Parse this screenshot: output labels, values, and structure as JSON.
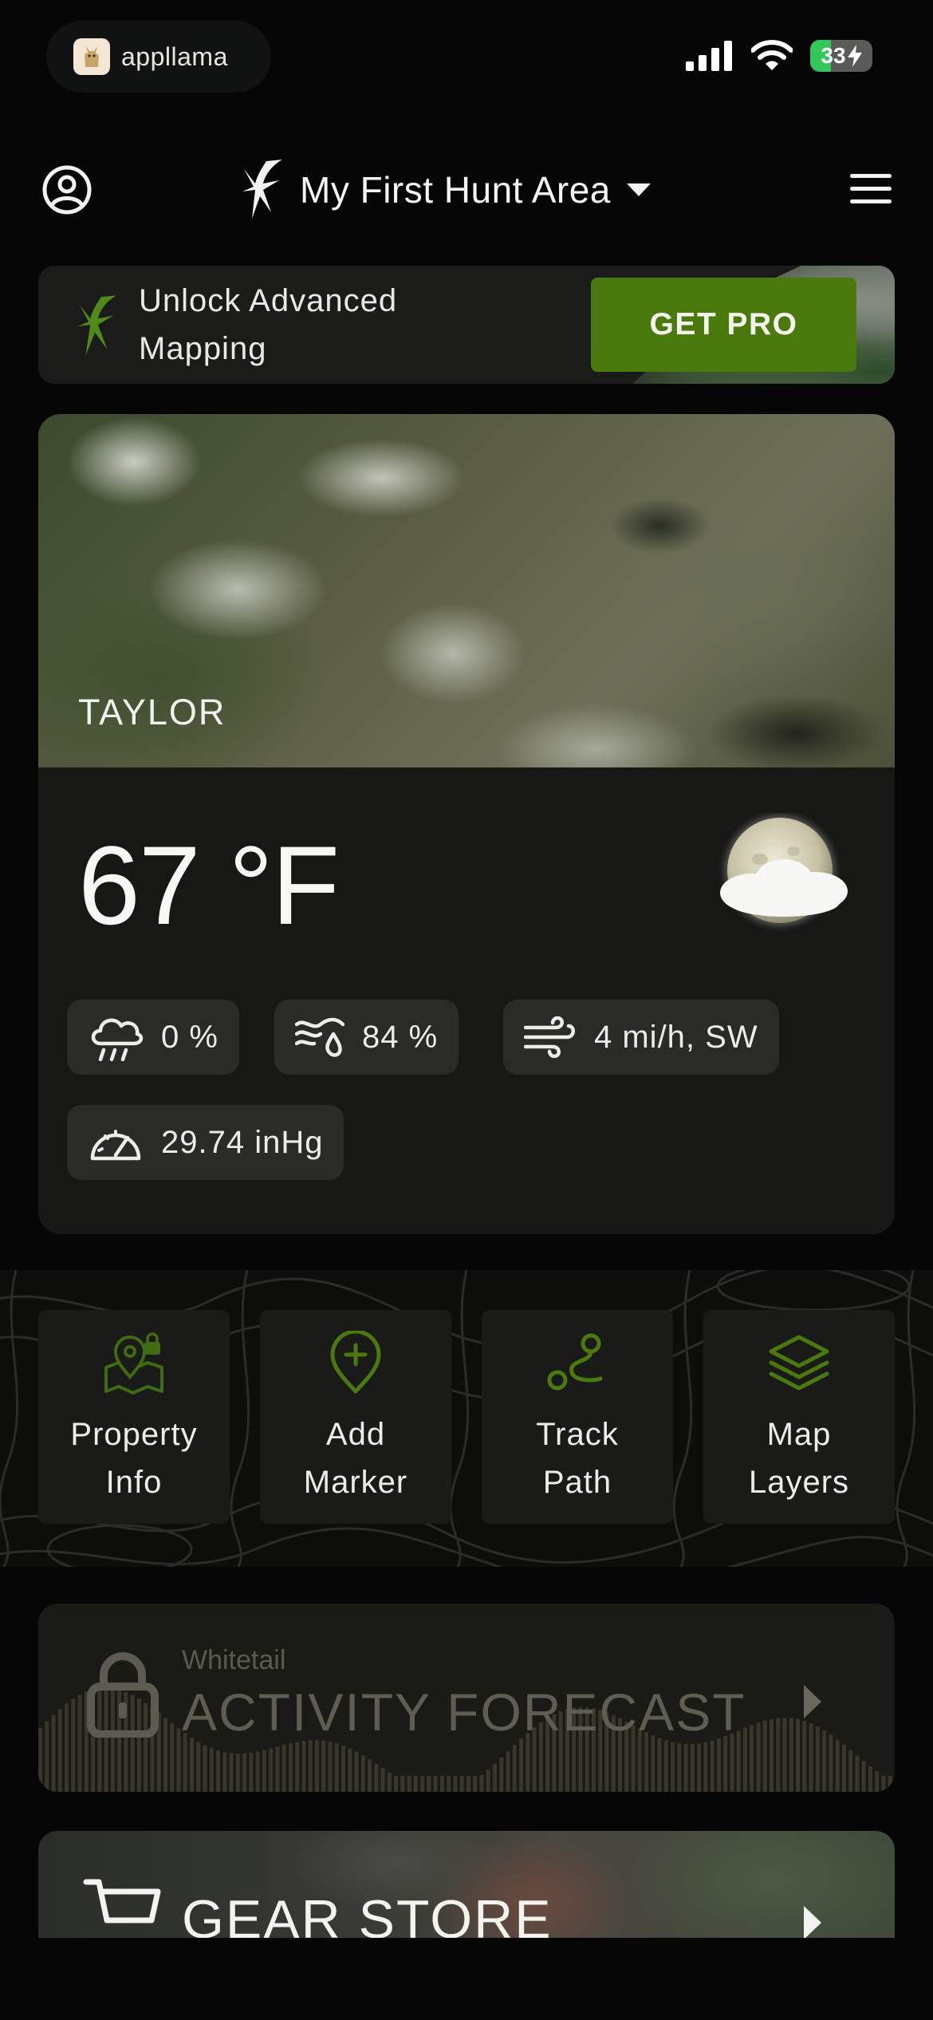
{
  "status_bar": {
    "app_pill_label": "appllama",
    "battery_level": "33",
    "battery_fraction": 0.33
  },
  "header": {
    "area_name": "My First Hunt Area"
  },
  "promo": {
    "text_line1": "Unlock Advanced",
    "text_line2": "Mapping",
    "button_label": "GET PRO"
  },
  "weather": {
    "location": "TAYLOR",
    "temperature": "67 °F",
    "precipitation": "0 %",
    "humidity": "84 %",
    "wind": "4 mi/h, SW",
    "pressure": "29.74 inHg",
    "condition_icon": "partly-cloudy-night-icon"
  },
  "actions": [
    {
      "line1": "Property",
      "line2": "Info",
      "icon": "map-lock-icon"
    },
    {
      "line1": "Add",
      "line2": "Marker",
      "icon": "add-marker-icon"
    },
    {
      "line1": "Track",
      "line2": "Path",
      "icon": "track-path-icon"
    },
    {
      "line1": "Map",
      "line2": "Layers",
      "icon": "layers-icon"
    }
  ],
  "forecast": {
    "species": "Whitetail",
    "title": "ACTIVITY FORECAST",
    "locked": true
  },
  "gear_store": {
    "title": "GEAR STORE"
  },
  "colors": {
    "accent_green": "#4a7a0e",
    "background": "#050605",
    "card": "#171816"
  }
}
